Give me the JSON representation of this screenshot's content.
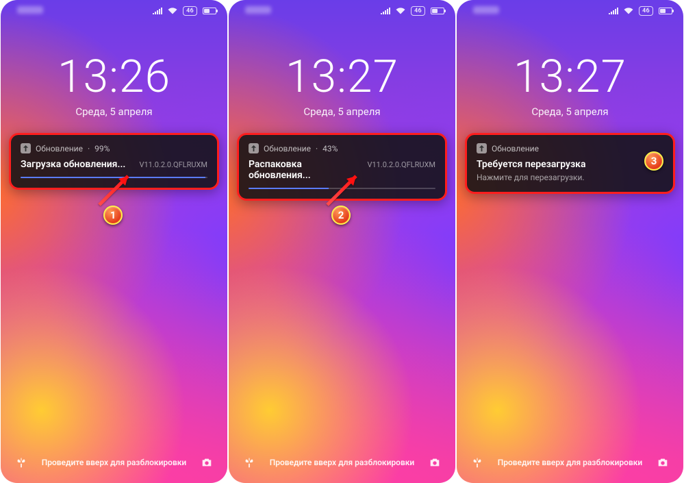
{
  "status_battery_label": "46",
  "phones": [
    {
      "clock": "13:26",
      "date": "Среда, 5 апреля",
      "notif": {
        "app": "Обновление",
        "percent": "99%",
        "title": "Загрузка обновления...",
        "version": "V11.0.2.0.QFLRUXM",
        "progress": 99,
        "has_progress": true
      },
      "step": "1"
    },
    {
      "clock": "13:27",
      "date": "Среда, 5 апреля",
      "notif": {
        "app": "Обновление",
        "percent": "43%",
        "title": "Распаковка обновления...",
        "version": "V11.0.2.0.QFLRUXM",
        "progress": 43,
        "has_progress": true
      },
      "step": "2"
    },
    {
      "clock": "13:27",
      "date": "Среда, 5 апреля",
      "notif": {
        "app": "Обновление",
        "title": "Требуется перезагрузка",
        "subtitle": "Нажмите для перезагрузки.",
        "has_progress": false
      },
      "step": "3"
    }
  ],
  "unlock_hint": "Проведите вверх для разблокировки"
}
